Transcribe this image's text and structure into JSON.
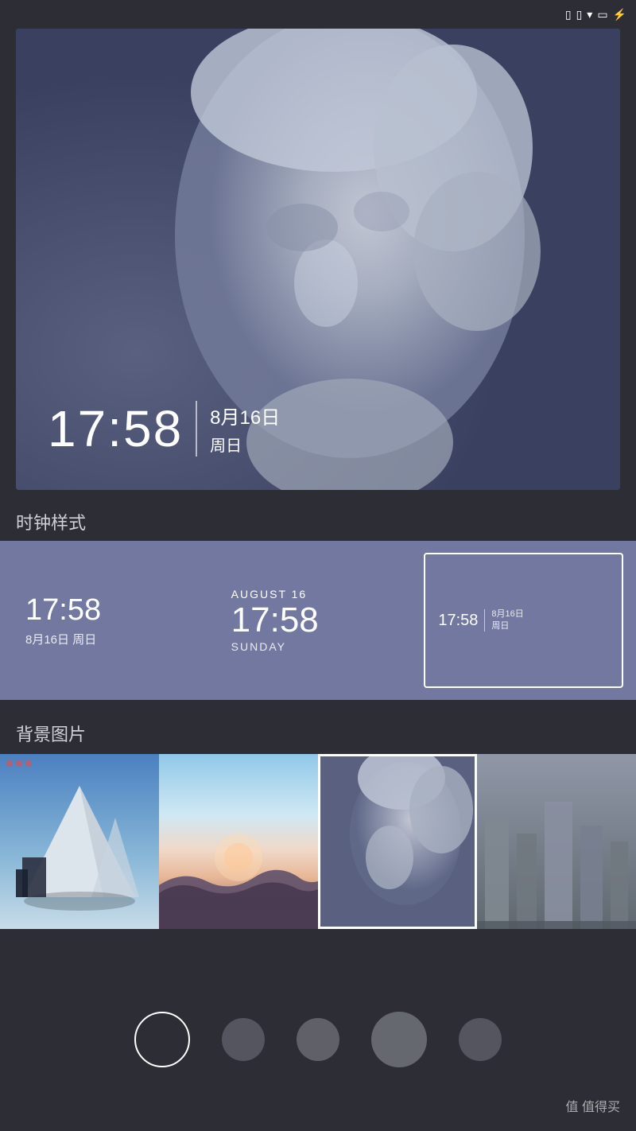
{
  "statusBar": {
    "icons": [
      "sim1",
      "sim2",
      "wifi",
      "battery",
      "charging"
    ]
  },
  "heroPreview": {
    "time": "17:58",
    "divider": "|",
    "date_line1": "8月16日",
    "date_line2": "周日"
  },
  "clockStyleSection": {
    "label": "时钟样式",
    "options": [
      {
        "id": "style1",
        "time": "17:58",
        "date": "8月16日 周日",
        "selected": false
      },
      {
        "id": "style2",
        "month": "AUGUST 16",
        "time": "17:58",
        "day": "SUNDAY",
        "selected": false
      },
      {
        "id": "style3",
        "time": "17:58",
        "date_line1": "8月16日",
        "date_line2": "周日",
        "selected": true
      }
    ]
  },
  "backgroundSection": {
    "label": "背景图片",
    "images": [
      {
        "id": "bg1",
        "alt": "architecture",
        "selected": false
      },
      {
        "id": "bg2",
        "alt": "sunset",
        "selected": false
      },
      {
        "id": "bg3",
        "alt": "statue",
        "selected": true
      },
      {
        "id": "bg4",
        "alt": "monuments",
        "selected": false
      }
    ]
  },
  "colorDots": [
    {
      "id": "dot1",
      "style": "outline"
    },
    {
      "id": "dot2",
      "style": "dark"
    },
    {
      "id": "dot3",
      "style": "dark"
    },
    {
      "id": "dot4",
      "style": "medium"
    },
    {
      "id": "dot5",
      "style": "dark"
    }
  ],
  "footer": {
    "watermark": "值得买"
  },
  "colors": {
    "background": "#2d2d35",
    "selectorBg": "#7278a0",
    "accent": "#ffffff"
  }
}
